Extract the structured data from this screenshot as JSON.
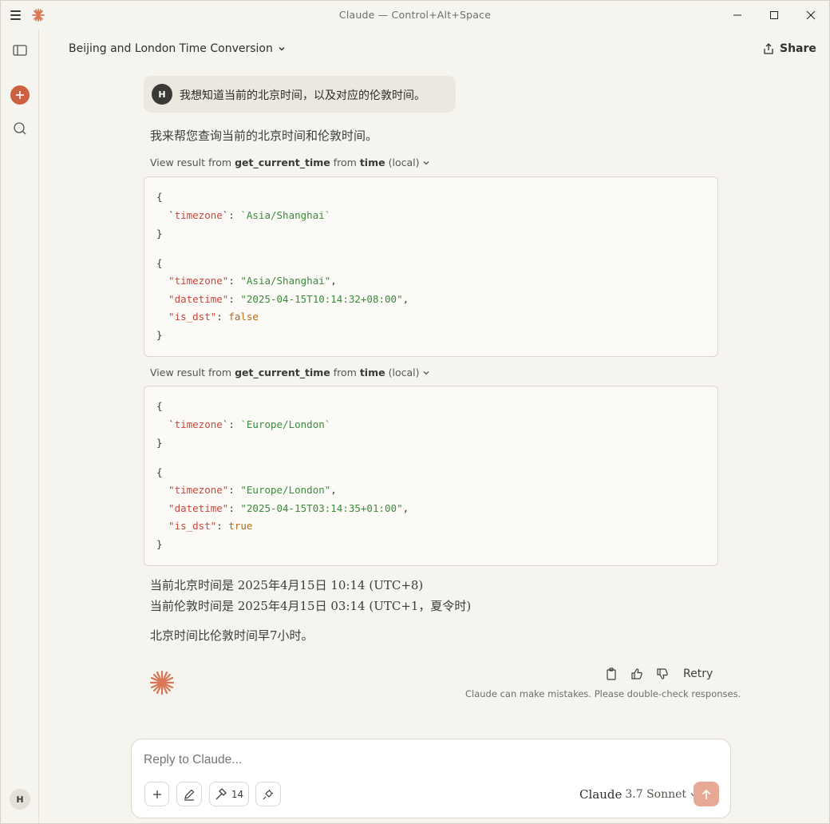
{
  "window": {
    "title": "Claude — Control+Alt+Space"
  },
  "header": {
    "conversation_title": "Beijing and London Time Conversion",
    "share_label": "Share"
  },
  "sidebar": {
    "avatar_initial": "H"
  },
  "messages": {
    "user": {
      "avatar_initial": "H",
      "text": "我想知道当前的北京时间，以及对应的伦敦时间。"
    },
    "assistant": {
      "intro": "我来帮您查询当前的北京时间和伦敦时间。",
      "tool_calls": [
        {
          "prefix": "View result from",
          "tool": "get_current_time",
          "mid": "from",
          "server": "time",
          "suffix": "(local)",
          "input_timezone": "Asia/Shanghai",
          "result": {
            "timezone": "Asia/Shanghai",
            "datetime": "2025-04-15T10:14:32+08:00",
            "is_dst": "false"
          }
        },
        {
          "prefix": "View result from",
          "tool": "get_current_time",
          "mid": "from",
          "server": "time",
          "suffix": "(local)",
          "input_timezone": "Europe/London",
          "result": {
            "timezone": "Europe/London",
            "datetime": "2025-04-15T03:14:35+01:00",
            "is_dst": "true"
          }
        }
      ],
      "answer_line1": "当前北京时间是 2025年4月15日 10:14 (UTC+8)",
      "answer_line2": "当前伦敦时间是 2025年4月15日 03:14 (UTC+1，夏令时)",
      "answer_line3": "北京时间比伦敦时间早7小时。",
      "retry_label": "Retry",
      "disclaimer": "Claude can make mistakes. Please double-check responses."
    }
  },
  "composer": {
    "placeholder": "Reply to Claude...",
    "tools_count": "14",
    "model_name": "Claude",
    "model_version": "3.7 Sonnet"
  },
  "colors": {
    "brand": "#cd6040",
    "background": "#f5f4ef",
    "json_key": "#c8463a",
    "json_string": "#3c8a3c",
    "json_bool": "#b06c18",
    "send_button": "#e7a995"
  }
}
